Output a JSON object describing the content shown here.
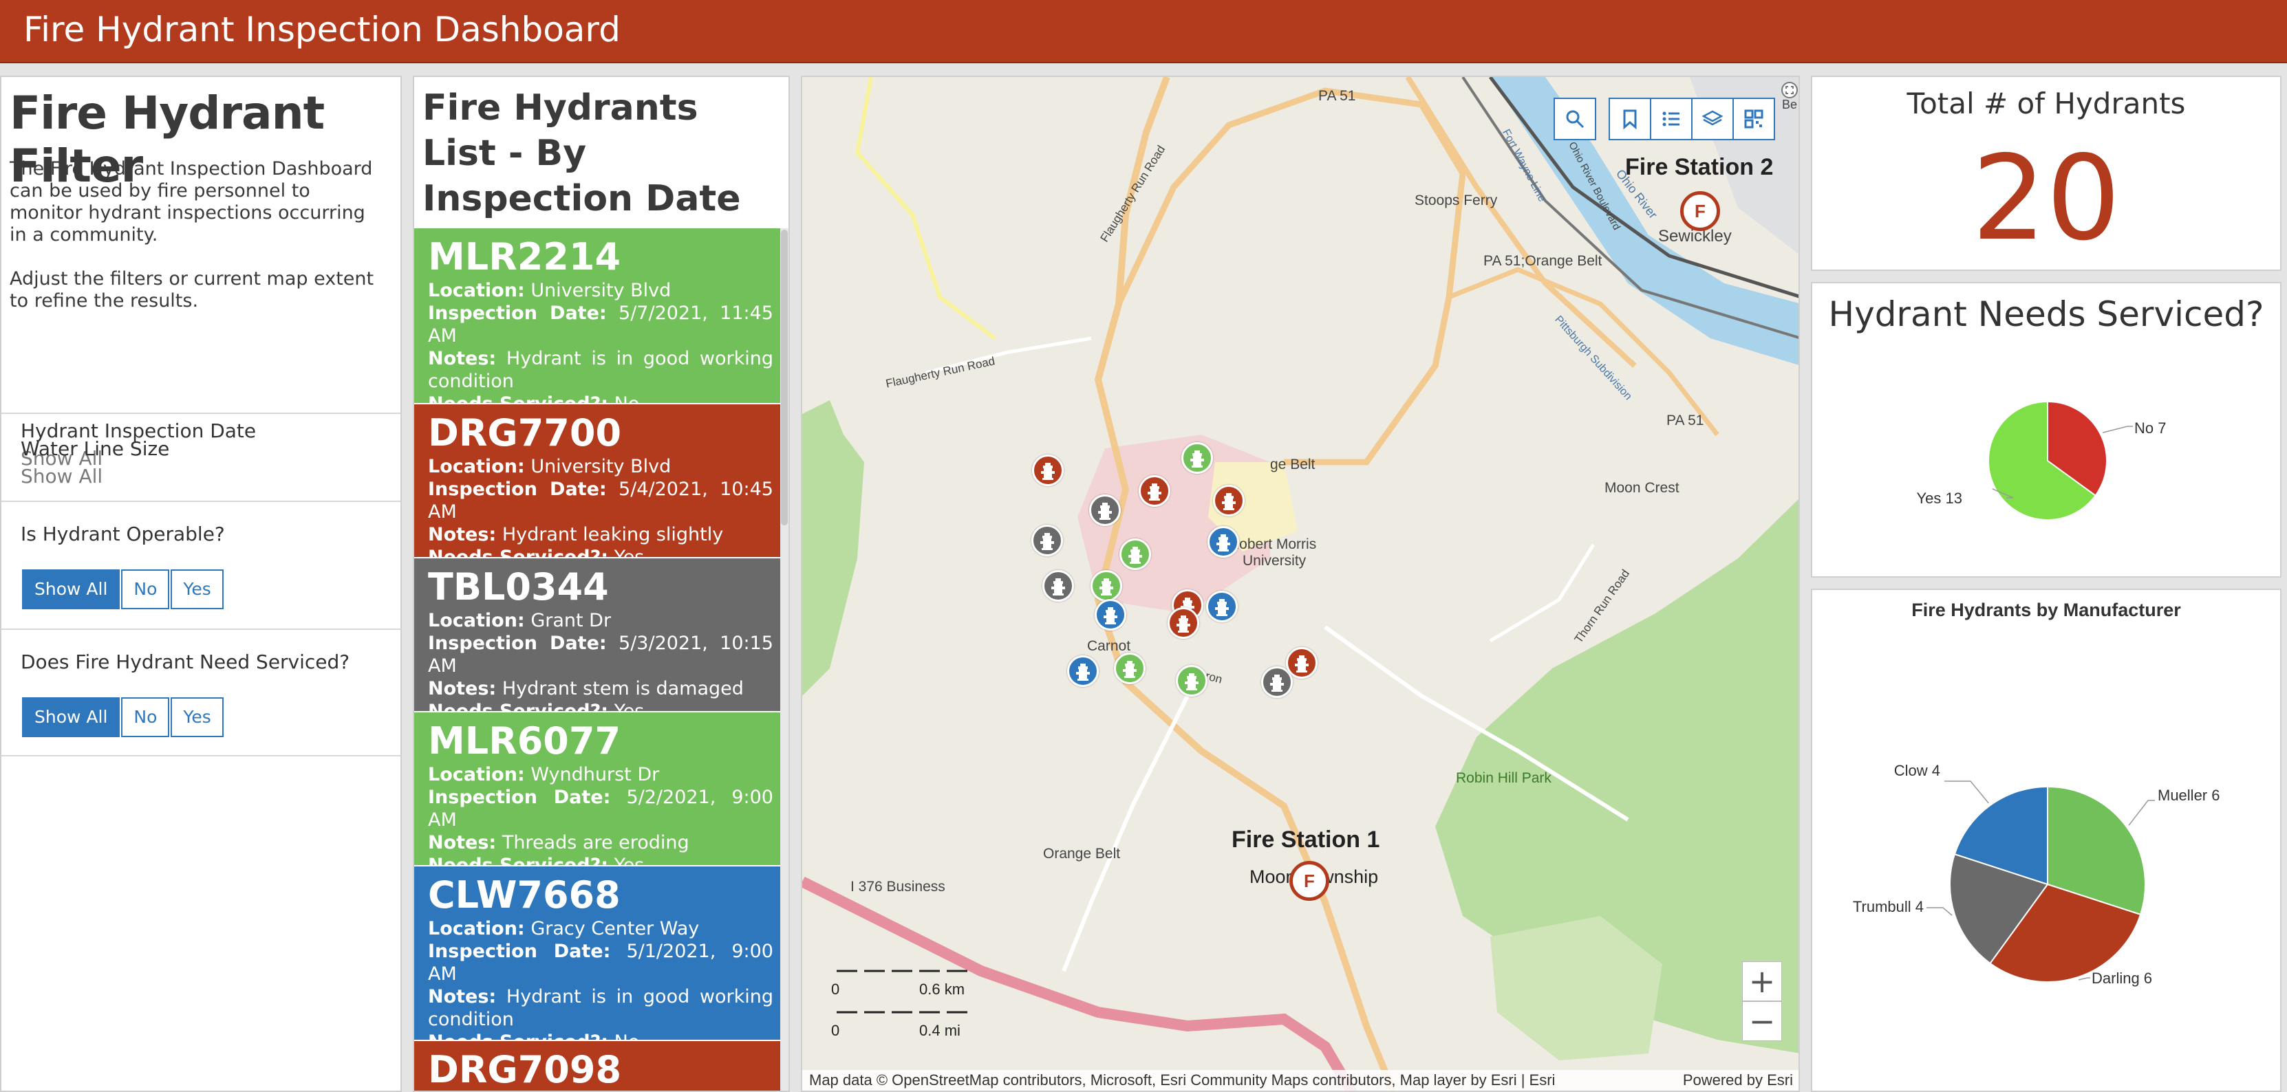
{
  "header": {
    "title": "Fire Hydrant Inspection Dashboard"
  },
  "filter": {
    "title": "Fire Hydrant Filter",
    "description_1": "The Fire Hydrant Inspection Dashboard can be used by fire personnel to monitor hydrant inspections occurring in a community.",
    "description_2": "Adjust the filters or current map extent to refine the results.",
    "date_label": "Hydrant Inspection Date",
    "date_value": "Show All",
    "water_label": "Water Line Size",
    "water_value": "Show All",
    "operable_label": "Is Hydrant Operable?",
    "serviced_label": "Does Fire Hydrant Need Serviced?",
    "options": [
      "Show All",
      "No",
      "Yes"
    ]
  },
  "list": {
    "title": "Fire Hydrants List - By Inspection Date (newest to oldest)",
    "location_label": "Location:",
    "date_label": "Inspection Date:",
    "notes_label": "Notes:",
    "serviced_label": "Needs Serviced?:",
    "cards": [
      {
        "id": "MLR2214",
        "location": "University Blvd",
        "date": "5/7/2021, 11:45 AM",
        "notes": "Hydrant is in good working condition",
        "serviced": "No",
        "color": "#72c05a"
      },
      {
        "id": "DRG7700",
        "location": "University Blvd",
        "date": "5/4/2021, 10:45 AM",
        "notes": "Hydrant leaking slightly",
        "serviced": "Yes",
        "color": "#b33b1d"
      },
      {
        "id": "TBL0344",
        "location": "Grant Dr",
        "date": "5/3/2021, 10:15 AM",
        "notes": "Hydrant stem is damaged",
        "serviced": "Yes",
        "color": "#6a6a6a"
      },
      {
        "id": "MLR6077",
        "location": "Wyndhurst Dr",
        "date": "5/2/2021, 9:00 AM",
        "notes": "Threads are eroding",
        "serviced": "Yes",
        "color": "#72c05a"
      },
      {
        "id": "CLW7668",
        "location": "Gracy Center Way",
        "date": "5/1/2021, 9:00 AM",
        "notes": "Hydrant is in good working condition",
        "serviced": "No",
        "color": "#2e77bc"
      },
      {
        "id": "DRG7098"
      }
    ]
  },
  "map": {
    "labels": {
      "pa51_top": "PA 51",
      "flaugherty1": "Flaugherty Run Road",
      "flaugherty2": "Flaugherty Run Road",
      "stoops": "Stoops Ferry",
      "pa51_orange": "PA 51;Orange Belt",
      "pa51_right": "PA 51",
      "sewickley": "Sewickley",
      "moon_crest": "Moon Crest",
      "orange_belt_top": "ge Belt",
      "robert_morris": "Robert Morris",
      "university": "University",
      "carnot": "Carnot",
      "sharon": "Sharon",
      "thorn_run": "Thorn Run Road",
      "robin_hill": "Robin Hill Park",
      "orange_belt_bottom": "Orange Belt",
      "i376": "I 376 Business",
      "moon_township": "Moon Township",
      "ohio_river": "Ohio River",
      "ohio_river_blvd": "Ohio River Boulevard",
      "fort_wayne": "Fort Wayne Line",
      "pittsburgh_sub": "Pittsburgh Subdivision",
      "be": "Be"
    },
    "stations": {
      "station1": "Fire Station 1",
      "station2": "Fire Station 2",
      "station_letter": "F"
    },
    "scale": {
      "km_zero": "0",
      "km": "0.6 km",
      "mi_zero": "0",
      "mi": "0.4 mi"
    },
    "zoom_in": "+",
    "zoom_out": "−",
    "attribution": "Map data © OpenStreetMap contributors, Microsoft, Esri Community Maps contributors, Map layer by Esri | Esri",
    "powered": "Powered by Esri",
    "toolbar_icons": [
      "search-icon",
      "bookmark-icon",
      "list-icon",
      "layers-icon",
      "qr-code-icon"
    ]
  },
  "total": {
    "title": "Total # of Hydrants",
    "count": "20"
  },
  "needs_serviced": {
    "title": "Hydrant Needs Serviced?",
    "chart_data": {
      "type": "pie",
      "categories": [
        "No",
        "Yes"
      ],
      "values": [
        7,
        13
      ],
      "labels": [
        "No 7",
        "Yes 13"
      ],
      "colors": [
        "#d0322a",
        "#7ee046"
      ]
    }
  },
  "manufacturer": {
    "title": "Fire Hydrants by Manufacturer",
    "chart_data": {
      "type": "pie",
      "categories": [
        "Mueller",
        "Darling",
        "Trumbull",
        "Clow"
      ],
      "values": [
        6,
        6,
        4,
        4
      ],
      "labels": [
        "Mueller 6",
        "Darling 6",
        "Trumbull 4",
        "Clow 4"
      ],
      "colors": [
        "#72c05a",
        "#b33b1d",
        "#6a6a6a",
        "#2e77bc"
      ]
    }
  }
}
